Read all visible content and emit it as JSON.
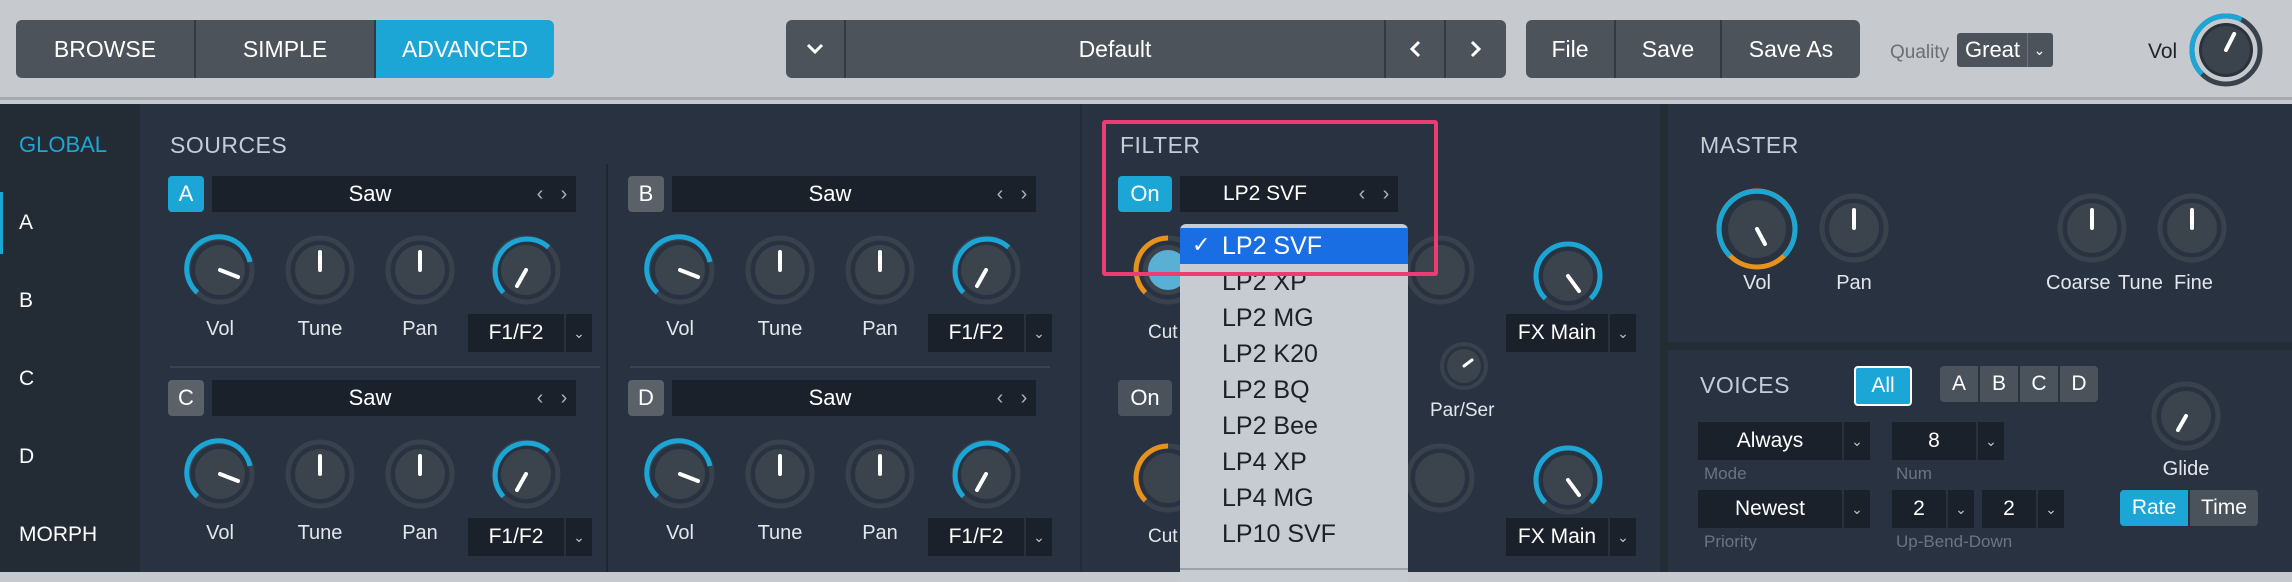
{
  "modes": [
    "BROWSE",
    "SIMPLE",
    "ADVANCED"
  ],
  "active_mode": "ADVANCED",
  "preset": {
    "name": "Default"
  },
  "file_buttons": [
    "File",
    "Save",
    "Save As"
  ],
  "quality": {
    "label": "Quality",
    "value": "Great"
  },
  "volume": {
    "label": "Vol",
    "level": 0.6
  },
  "nav": [
    "GLOBAL",
    "A",
    "B",
    "C",
    "D",
    "MORPH"
  ],
  "sources": {
    "title": "SOURCES",
    "slots": [
      {
        "id": "A",
        "wave": "Saw",
        "routing": "F1/F2",
        "knobs": [
          "Vol",
          "Tune",
          "Pan"
        ]
      },
      {
        "id": "B",
        "wave": "Saw",
        "routing": "F1/F2",
        "knobs": [
          "Vol",
          "Tune",
          "Pan"
        ]
      },
      {
        "id": "C",
        "wave": "Saw",
        "routing": "F1/F2",
        "knobs": [
          "Vol",
          "Tune",
          "Pan"
        ]
      },
      {
        "id": "D",
        "wave": "Saw",
        "routing": "F1/F2",
        "knobs": [
          "Vol",
          "Tune",
          "Pan"
        ]
      }
    ]
  },
  "filter": {
    "title": "FILTER",
    "on_label": "On",
    "type": "LP2 SVF",
    "cutoff_label": "Cut",
    "par_ser_label": "Par/Ser",
    "fx_label": "FX Main",
    "dropdown_options": [
      "LP2 SVF",
      "LP2 XP",
      "LP2 MG",
      "LP2 K20",
      "LP2 BQ",
      "LP2 Bee",
      "LP4 XP",
      "LP4 MG",
      "LP10 SVF"
    ],
    "check_mark": "✓"
  },
  "master": {
    "title": "MASTER",
    "knobs": [
      "Vol",
      "Pan",
      "Coarse",
      "Tune",
      "Fine"
    ]
  },
  "voices": {
    "title": "VOICES",
    "all_label": "All",
    "slots": [
      "A",
      "B",
      "C",
      "D"
    ],
    "mode": {
      "value": "Always",
      "label": "Mode"
    },
    "num": {
      "value": "8",
      "label": "Num"
    },
    "priority": {
      "value": "Newest",
      "label": "Priority"
    },
    "up_bend": {
      "value": "2",
      "label": "Up-Bend-Down"
    },
    "down_bend": {
      "value": "2"
    },
    "glide_label": "Glide",
    "rate_label": "Rate",
    "time_label": "Time"
  },
  "colors": {
    "accent": "#1ca6d6",
    "highlight": "#ec3c74",
    "dropdown_selected": "#1a6ee3",
    "orange": "#e8921e"
  }
}
